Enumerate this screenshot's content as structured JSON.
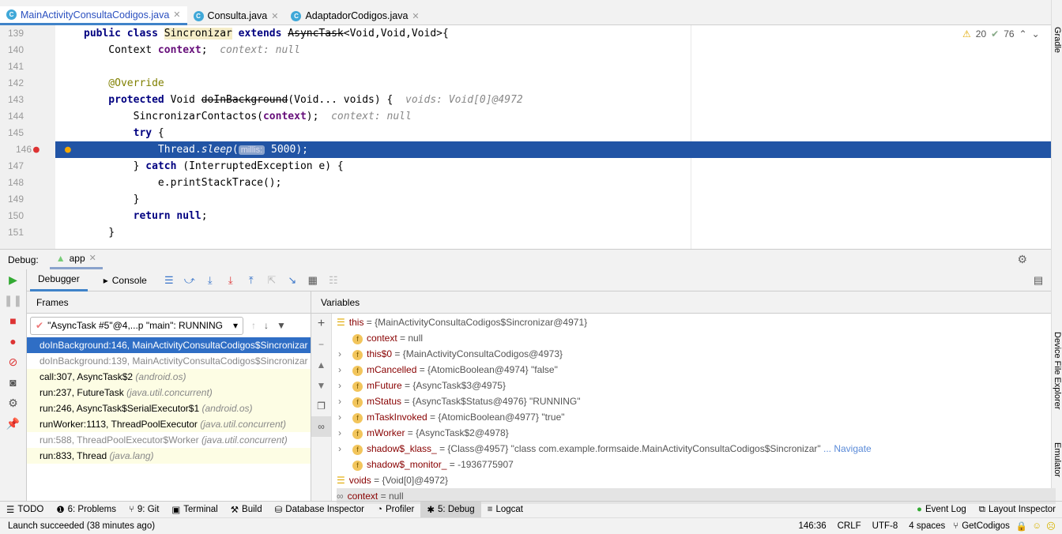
{
  "tabs": [
    {
      "label": "MainActivityConsultaCodigos.java",
      "active": true
    },
    {
      "label": "Consulta.java"
    },
    {
      "label": "AdaptadorCodigos.java"
    }
  ],
  "editor": {
    "warnings": "20",
    "weak_warnings": "76",
    "lines": [
      {
        "n": "139"
      },
      {
        "n": "140"
      },
      {
        "n": "141"
      },
      {
        "n": "142"
      },
      {
        "n": "143"
      },
      {
        "n": "144"
      },
      {
        "n": "145"
      },
      {
        "n": "146"
      },
      {
        "n": "147"
      },
      {
        "n": "148"
      },
      {
        "n": "149"
      },
      {
        "n": "150"
      },
      {
        "n": "151"
      }
    ],
    "code": {
      "l139a": "public class ",
      "l139b": "Sincronizar",
      "l139c": " extends ",
      "l139d": "AsyncTask",
      "l139e": "<Void,Void,Void>{",
      "l140a": "    Context ",
      "l140b": "context",
      "l140c": ";",
      "l140h": "  context: null",
      "l142": "    @Override",
      "l143a": "    protected ",
      "l143b": "Void ",
      "l143c": "doInBackground",
      "l143d": "(Void... voids) {",
      "l143h": "  voids: Void[0]@4972",
      "l144a": "        SincronizarContactos(",
      "l144b": "context",
      "l144c": ");",
      "l144h": "  context: null",
      "l145a": "        try",
      "l145b": " {",
      "l146a": "            Thread.",
      "l146b": "sleep",
      "l146c": "(",
      "l146chip": "millis:",
      "l146d": " 5000);",
      "l147a": "        } ",
      "l147b": "catch",
      "l147c": " (InterruptedException e) {",
      "l148": "            e.printStackTrace();",
      "l149": "        }",
      "l150a": "        return null",
      "l150b": ";",
      "l151": "    }"
    }
  },
  "right_stripe": {
    "gradle": "Gradle",
    "device_file_explorer": "Device File Explorer",
    "emulator": "Emulator"
  },
  "debug": {
    "label": "Debug:",
    "session": "app",
    "tabs": {
      "debugger": "Debugger",
      "console": "Console"
    },
    "frames_title": "Frames",
    "variables_title": "Variables",
    "thread": "\"AsyncTask #5\"@4,...p \"main\": RUNNING",
    "frames": [
      {
        "m": "doInBackground:146, MainActivityConsultaCodigos$Sincronizar",
        "p": "(",
        "state": "selected"
      },
      {
        "m": "doInBackground:139, MainActivityConsultaCodigos$Sincronizar",
        "p": "(",
        "state": "lib"
      },
      {
        "m": "call:307, AsyncTask$2",
        "p": "(android.os)"
      },
      {
        "m": "run:237, FutureTask",
        "p": "(java.util.concurrent)"
      },
      {
        "m": "run:246, AsyncTask$SerialExecutor$1",
        "p": "(android.os)"
      },
      {
        "m": "runWorker:1113, ThreadPoolExecutor",
        "p": "(java.util.concurrent)"
      },
      {
        "m": "run:588, ThreadPoolExecutor$Worker",
        "p": "(java.util.concurrent)",
        "state": "lib"
      },
      {
        "m": "run:833, Thread",
        "p": "(java.lang)"
      }
    ],
    "variables": [
      {
        "n": "this",
        "v": " = {MainActivityConsultaCodigos$Sincronizar@4971}",
        "lvl": 0,
        "exp": "open",
        "icon": "list"
      },
      {
        "n": "context",
        "v": " = null",
        "lvl": 1,
        "exp": ""
      },
      {
        "n": "this$0",
        "v": " = {MainActivityConsultaCodigos@4973}",
        "lvl": 1,
        "exp": "closed"
      },
      {
        "n": "mCancelled",
        "v": " = {AtomicBoolean@4974} \"false\"",
        "lvl": 1,
        "exp": "closed"
      },
      {
        "n": "mFuture",
        "v": " = {AsyncTask$3@4975}",
        "lvl": 1,
        "exp": "closed"
      },
      {
        "n": "mStatus",
        "v": " = {AsyncTask$Status@4976} \"RUNNING\"",
        "lvl": 1,
        "exp": "closed"
      },
      {
        "n": "mTaskInvoked",
        "v": " = {AtomicBoolean@4977} \"true\"",
        "lvl": 1,
        "exp": "closed"
      },
      {
        "n": "mWorker",
        "v": " = {AsyncTask$2@4978}",
        "lvl": 1,
        "exp": "closed"
      },
      {
        "n": "shadow$_klass_",
        "v": " = {Class@4957} \"class com.example.formsaide.MainActivityConsultaCodigos$Sincronizar\"",
        "lvl": 1,
        "exp": "closed",
        "link": "... Navigate"
      },
      {
        "n": "shadow$_monitor_",
        "v": " = -1936775907",
        "lvl": 1,
        "exp": ""
      },
      {
        "n": "voids",
        "v": " = {Void[0]@4972}",
        "lvl": 0,
        "exp": "",
        "icon": "list"
      },
      {
        "n": "context",
        "v": " = null",
        "lvl": 0,
        "exp": "",
        "icon": "watch"
      }
    ]
  },
  "bottom_tools": [
    {
      "icon": "☰",
      "label": "TODO"
    },
    {
      "icon": "❶",
      "label": "6: Problems"
    },
    {
      "icon": "⑂",
      "label": "9: Git"
    },
    {
      "icon": "▣",
      "label": "Terminal"
    },
    {
      "icon": "⚒",
      "label": "Build"
    },
    {
      "icon": "⛁",
      "label": "Database Inspector"
    },
    {
      "icon": "◔",
      "label": "Profiler"
    },
    {
      "icon": "✱",
      "label": "5: Debug",
      "active": true
    },
    {
      "icon": "≡",
      "label": "Logcat"
    }
  ],
  "bottom_right": [
    {
      "icon": "●",
      "label": "Event Log"
    },
    {
      "icon": "⧉",
      "label": "Layout Inspector"
    }
  ],
  "status": {
    "message": "Launch succeeded (38 minutes ago)",
    "position": "146:36",
    "line_sep": "CRLF",
    "encoding": "UTF-8",
    "indent": "4 spaces",
    "branch": "GetCodigos"
  },
  "colors": {
    "accent": "#4083c9",
    "selection": "#2154a5",
    "keyword": "#000080",
    "field": "#660e7a"
  }
}
